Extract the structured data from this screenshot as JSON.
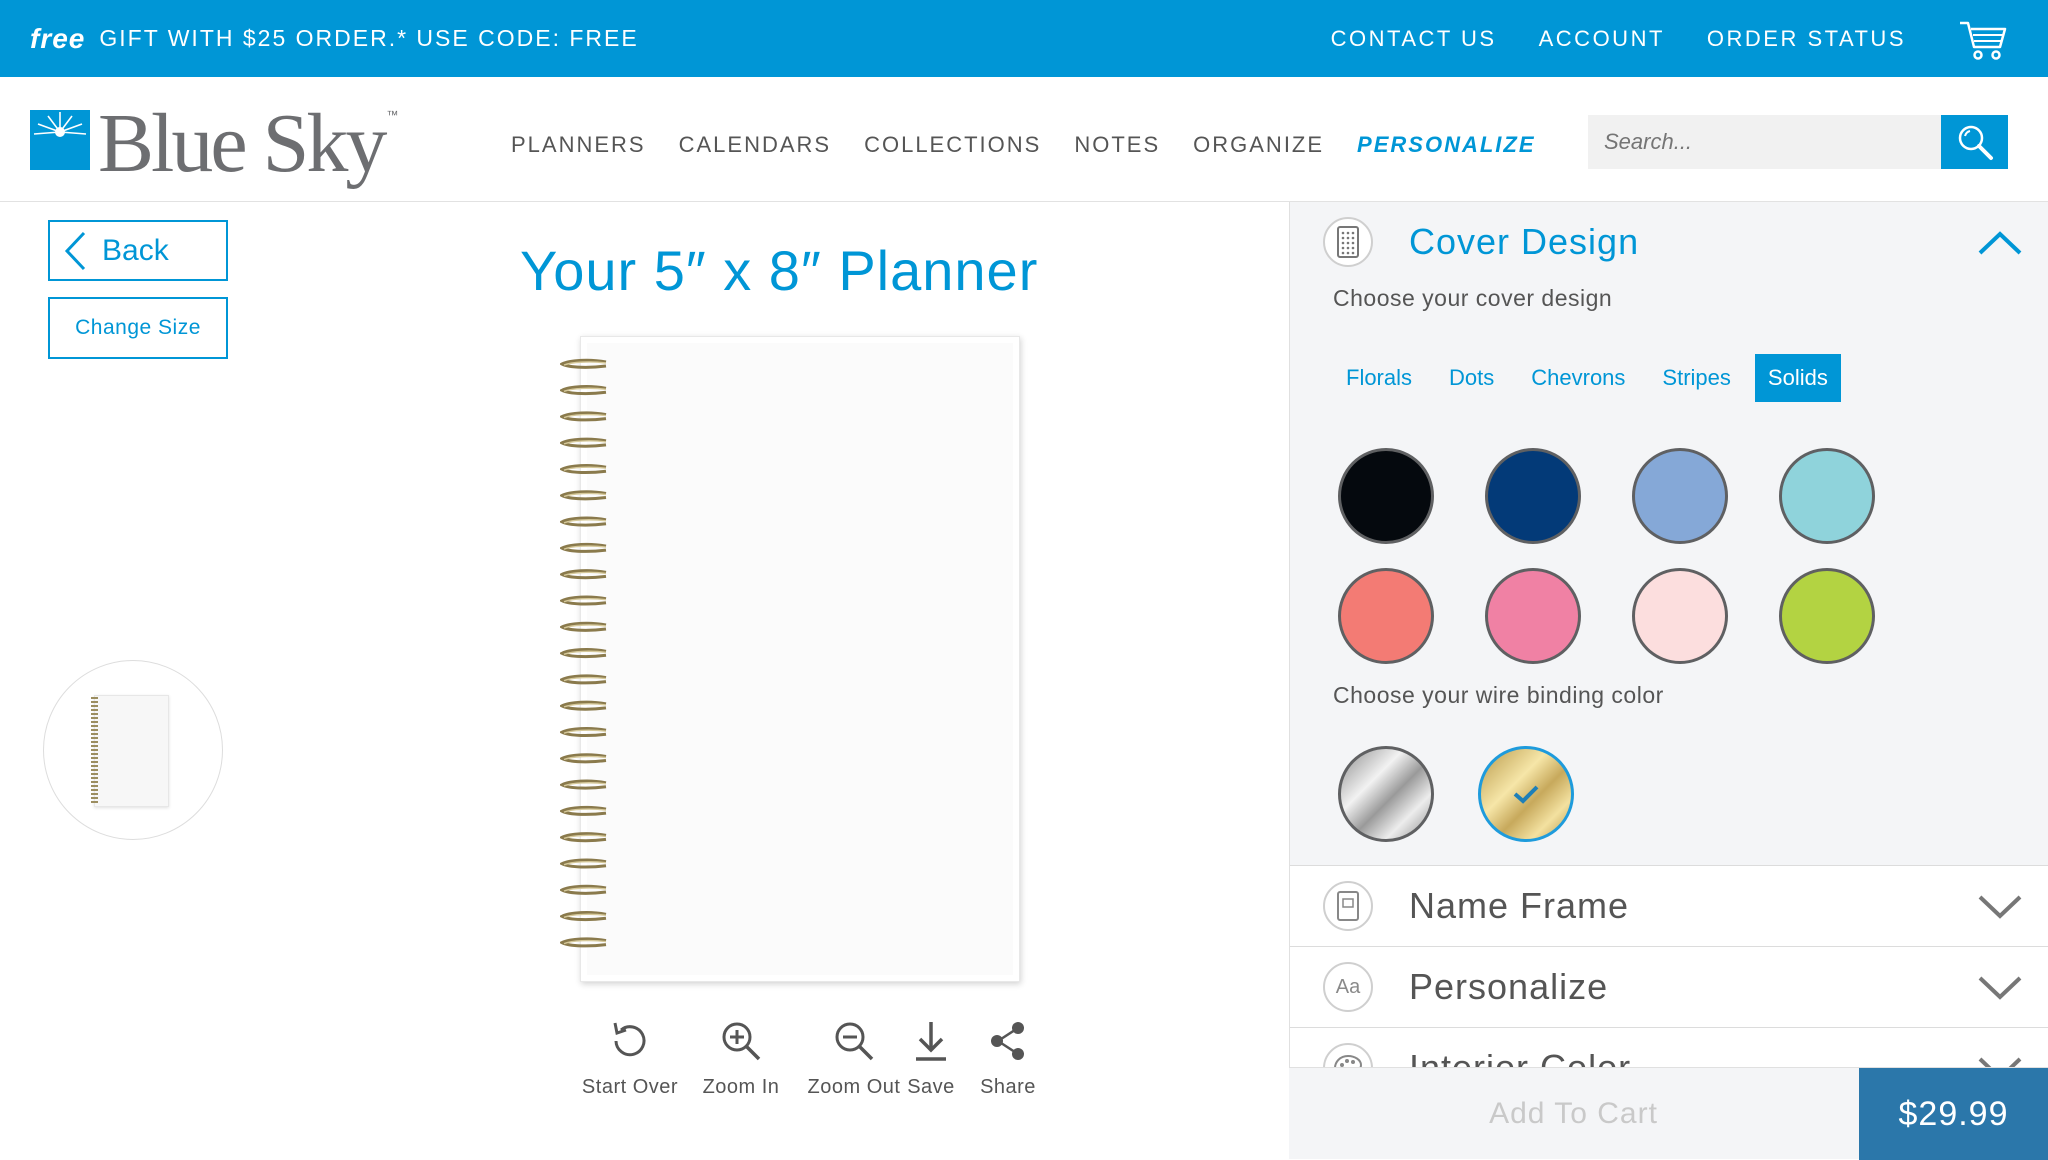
{
  "promo": {
    "free": "free",
    "text": "GIFT WITH $25 ORDER.* USE CODE: FREE",
    "links": [
      "CONTACT US",
      "ACCOUNT",
      "ORDER STATUS"
    ],
    "color": "#0096d6"
  },
  "header": {
    "logo_text": "Blue Sky",
    "logo_tm": "™",
    "nav": [
      "PLANNERS",
      "CALENDARS",
      "COLLECTIONS",
      "NOTES",
      "ORGANIZE",
      "PERSONALIZE"
    ],
    "active_nav": "PERSONALIZE",
    "search_placeholder": "Search..."
  },
  "left": {
    "back_label": "Back",
    "change_size_label": "Change Size"
  },
  "center": {
    "title": "Your 5″ x 8″ Planner",
    "tools": [
      "Start Over",
      "Zoom In",
      "Zoom Out",
      "Save",
      "Share"
    ]
  },
  "panel": {
    "cover": {
      "title": "Cover Design",
      "subtitle": "Choose your cover design",
      "tabs": [
        "Florals",
        "Dots",
        "Chevrons",
        "Stripes",
        "Solids"
      ],
      "active_tab": "Solids",
      "colors": [
        "#05090e",
        "#033a78",
        "#85a8d7",
        "#8fd3db",
        "#f37b74",
        "#f081a4",
        "#fcdede",
        "#b3d342"
      ],
      "wire_label": "Choose your wire binding color",
      "wire_colors": [
        "silver",
        "gold"
      ],
      "wire_selected": "gold"
    },
    "sections": [
      "Name Frame",
      "Personalize",
      "Interior Color"
    ],
    "section_icons": [
      "frame-icon",
      "aa-text-icon",
      "palette-icon"
    ],
    "aa": "Aa"
  },
  "cart": {
    "add_label": "Add To Cart",
    "price": "$29.99"
  }
}
